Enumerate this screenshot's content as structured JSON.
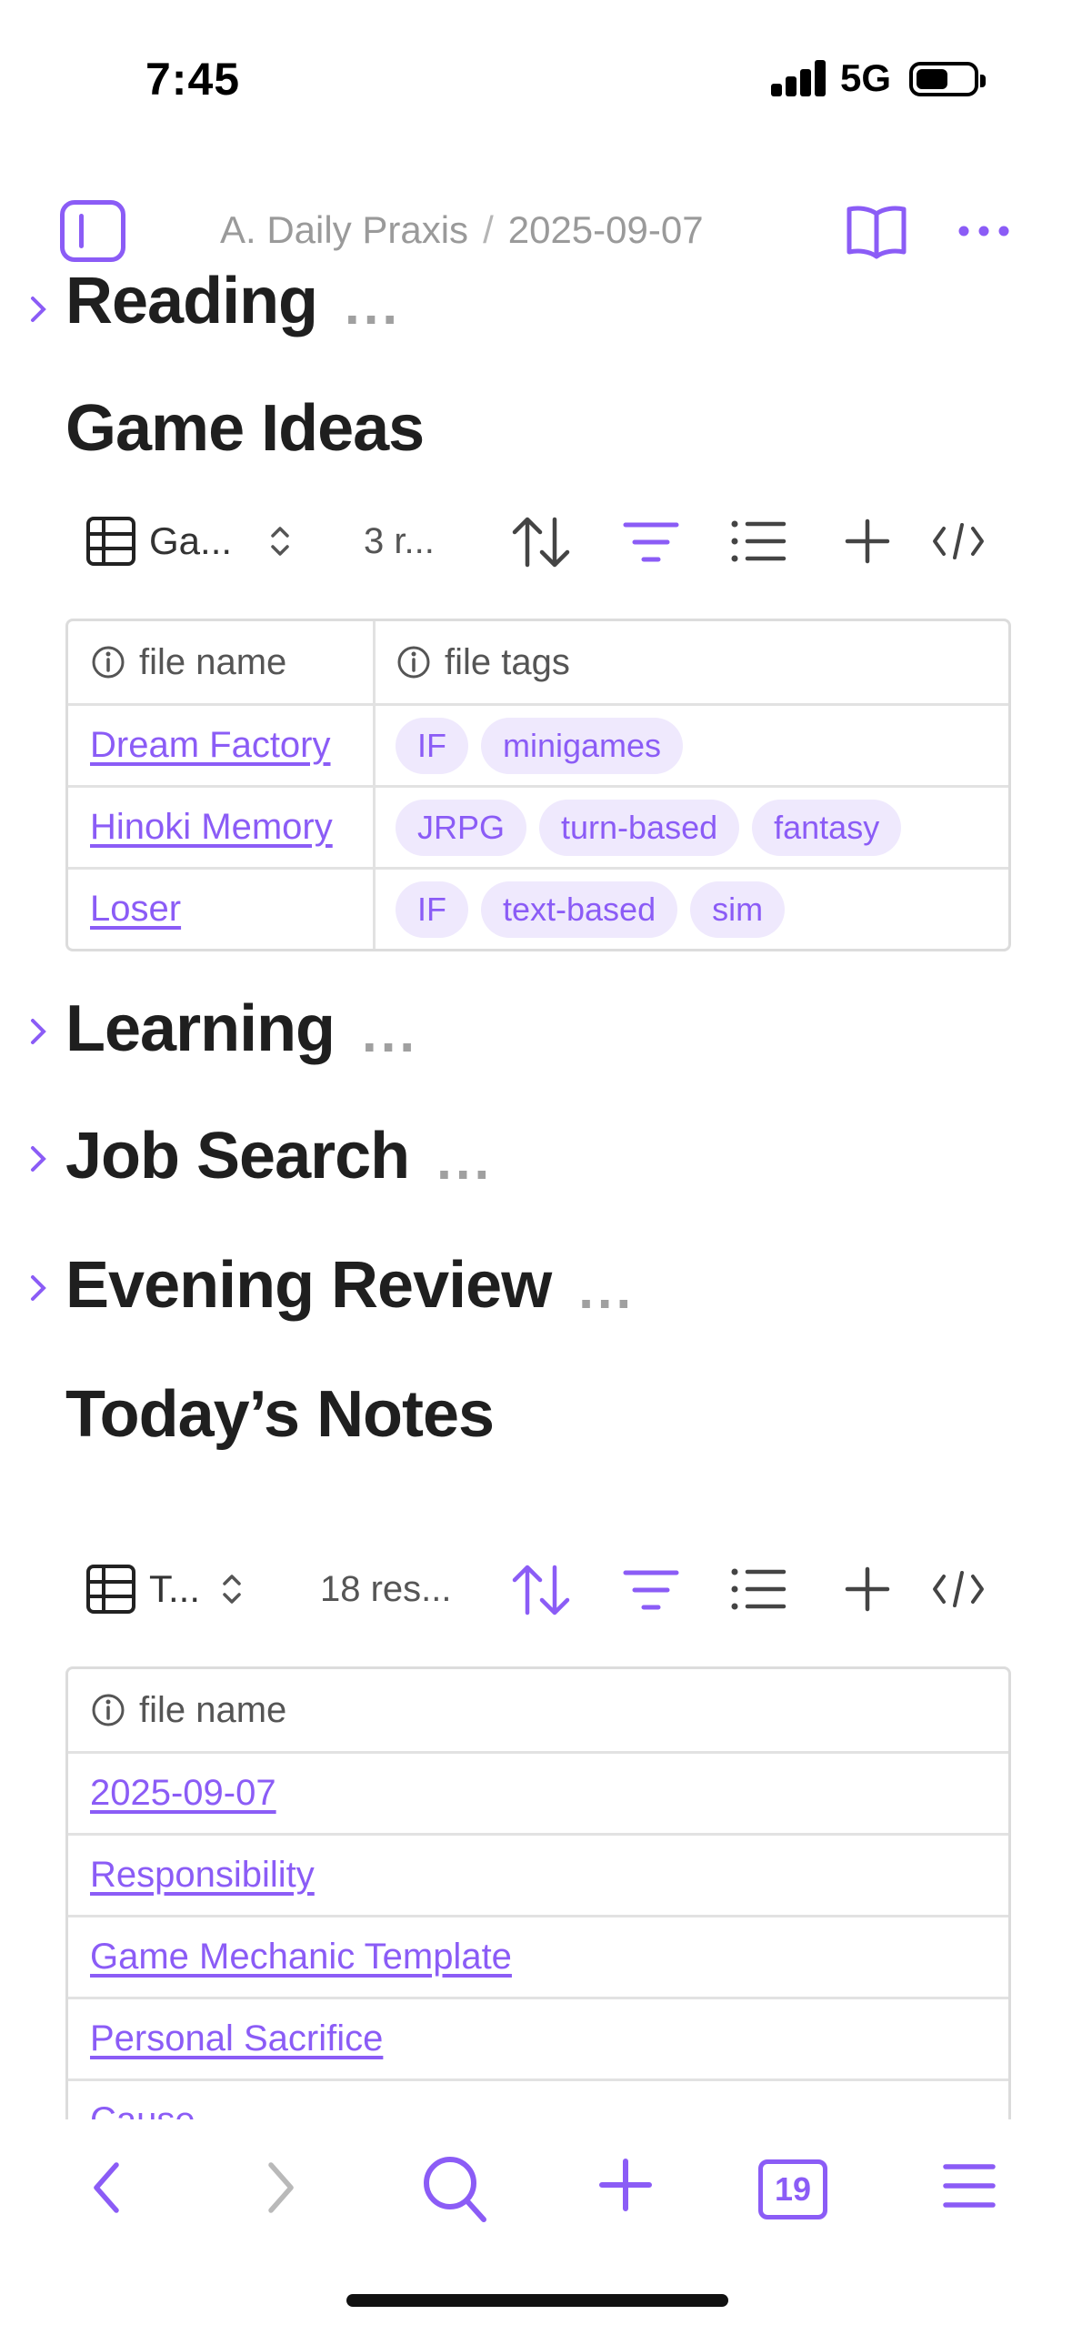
{
  "status_bar": {
    "time": "7:45",
    "network": "5G"
  },
  "header": {
    "breadcrumb_parent": "A. Daily Praxis",
    "breadcrumb_separator": "/",
    "breadcrumb_current": "2025-09-07"
  },
  "sections": {
    "reading": {
      "title": "Reading",
      "more": "..."
    },
    "game_ideas": {
      "title": "Game Ideas"
    },
    "learning": {
      "title": "Learning",
      "more": "..."
    },
    "job_search": {
      "title": "Job Search",
      "more": "..."
    },
    "evening_review": {
      "title": "Evening Review",
      "more": "..."
    },
    "todays_notes": {
      "title": "Today’s Notes"
    }
  },
  "game_base": {
    "view_name": "Ga...",
    "result_count": "3 r...",
    "columns": [
      "file name",
      "file tags"
    ],
    "rows": [
      {
        "name": "Dream Factory",
        "tags": [
          "IF",
          "minigames"
        ]
      },
      {
        "name": "Hinoki Memory",
        "tags": [
          "JRPG",
          "turn-based",
          "fantasy"
        ]
      },
      {
        "name": "Loser",
        "tags": [
          "IF",
          "text-based",
          "sim"
        ]
      }
    ]
  },
  "notes_base": {
    "view_name": "T...",
    "result_count": "18 res...",
    "columns": [
      "file name"
    ],
    "rows": [
      "2025-09-07",
      "Responsibility",
      "Game Mechanic Template",
      "Personal Sacrifice",
      "Cause"
    ]
  },
  "bottom_bar": {
    "calendar_day": "19"
  },
  "colors": {
    "accent": "#8b5cf6",
    "tag_bg": "#efe9fd",
    "text": "#222222",
    "muted": "#9a9a9a"
  }
}
